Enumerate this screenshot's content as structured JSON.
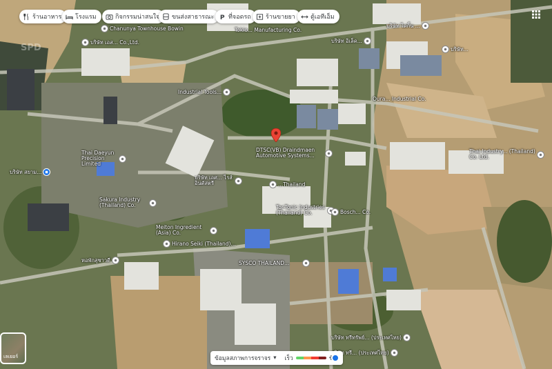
{
  "top_bar": {
    "chips": [
      {
        "label": "ร้านอาหาร",
        "icon": "fork-knife-icon"
      },
      {
        "label": "โรงแรม",
        "icon": "bed-icon"
      },
      {
        "label": "กิจกรรมน่าสนใจ",
        "icon": "camera-icon"
      },
      {
        "label": "ขนส่งสาธารณะ",
        "icon": "bus-icon"
      },
      {
        "label": "ที่จอดรถ",
        "icon": "parking-icon"
      },
      {
        "label": "ร้านขายยา",
        "icon": "pharmacy-icon"
      },
      {
        "label": "ตู้เอทีเอ็ม",
        "icon": "atm-icon"
      }
    ],
    "apps_icon": "apps-grid-icon"
  },
  "watermark": "SPD",
  "selected_place": {
    "label": "DTSC(VB) Draindmaen Automotive Systems...",
    "pin_color": "#ea4335"
  },
  "pois": [
    {
      "label": "Chanunya Townhouse Bowin"
    },
    {
      "label": "บริษัท เอส... Co.,Ltd."
    },
    {
      "label": "บริษัท อิเล็ค..."
    },
    {
      "label": "บริษัท ไดกิ้น ..."
    },
    {
      "label": "บริษัท..."
    },
    {
      "label": "Industrial Tools..."
    },
    {
      "label": "Thai Daeyun Precision Limited"
    },
    {
      "label": "บริษัท สยาม..."
    },
    {
      "label": "บริษัท เอศ... ไรส์ อินดัสตรี"
    },
    {
      "label": "Thai Industry... (Thailand) Co. Ltd."
    },
    {
      "label": "...Thailand"
    },
    {
      "label": "Tor-Tonic Industries (Thailand) Co."
    },
    {
      "label": "Sakura Industry (Thailand) Co."
    },
    {
      "label": "Meiton Ingredient (Asia) Co."
    },
    {
      "label": "Hirano Seiki (Thailand)..."
    },
    {
      "label": "Bosch... Co."
    },
    {
      "label": "SYSCO THAILAND..."
    },
    {
      "label": "บริษัท ทรีทรัพย์... (ประเทศไทย)"
    },
    {
      "label": "บริษัท ทรี... (ประเทศไทย)"
    },
    {
      "label": "หอพักสุชาวดี"
    },
    {
      "label": "Oura... Industrial Co."
    },
    {
      "label": "Tokio... Manufacturing Co."
    }
  ],
  "legend": {
    "label": "ข้อมูลสภาพการจราจร",
    "fast": "เร็ว",
    "slow": "ช้า",
    "colors": [
      "#63d668",
      "#ff974d",
      "#f23c32",
      "#811f1f"
    ]
  },
  "layers_button": {
    "label": "เลเยอร์"
  },
  "colors": {
    "accent_blue": "#1a73e8",
    "chip_bg": "#ffffff"
  }
}
